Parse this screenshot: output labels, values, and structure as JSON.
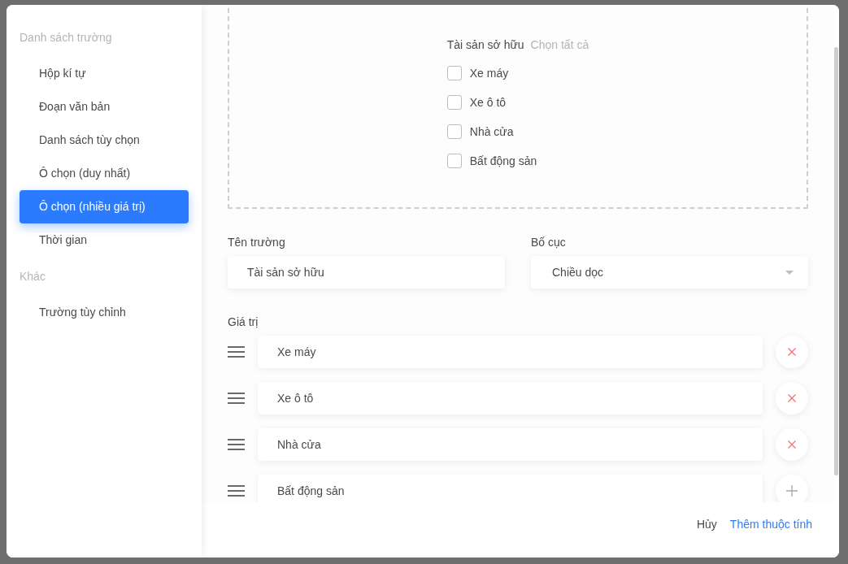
{
  "sidebar": {
    "sections": [
      {
        "heading": "Danh sách trường",
        "items": [
          {
            "label": "Hộp kí tự",
            "selected": false
          },
          {
            "label": "Đoạn văn bản",
            "selected": false
          },
          {
            "label": "Danh sách tùy chọn",
            "selected": false
          },
          {
            "label": "Ô chọn (duy nhất)",
            "selected": false
          },
          {
            "label": "Ô chọn (nhiều giá trị)",
            "selected": true
          },
          {
            "label": "Thời gian",
            "selected": false
          }
        ]
      },
      {
        "heading": "Khác",
        "items": [
          {
            "label": "Trường tùy chỉnh",
            "selected": false
          }
        ]
      }
    ]
  },
  "preview": {
    "field_label": "Tài sản sở hữu",
    "select_all": "Chọn tất cả",
    "options": [
      {
        "label": "Xe máy",
        "checked": false
      },
      {
        "label": "Xe ô tô",
        "checked": false
      },
      {
        "label": "Nhà cửa",
        "checked": false
      },
      {
        "label": "Bất động sản",
        "checked": false
      }
    ]
  },
  "form": {
    "name_field": {
      "label": "Tên trường",
      "value": "Tài sản sở hữu"
    },
    "layout_field": {
      "label": "Bố cục",
      "value": "Chiều dọc"
    }
  },
  "values": {
    "label": "Giá trị",
    "rows": [
      {
        "value": "Xe máy",
        "kind": "remove"
      },
      {
        "value": "Xe ô tô",
        "kind": "remove"
      },
      {
        "value": "Nhà cửa",
        "kind": "remove"
      },
      {
        "value": "Bất động sản",
        "kind": "add"
      }
    ]
  },
  "footer": {
    "buttons": [
      {
        "label": "Hủy",
        "kind": "plain"
      },
      {
        "label": "Thêm thuộc tính",
        "kind": "primary"
      }
    ]
  }
}
